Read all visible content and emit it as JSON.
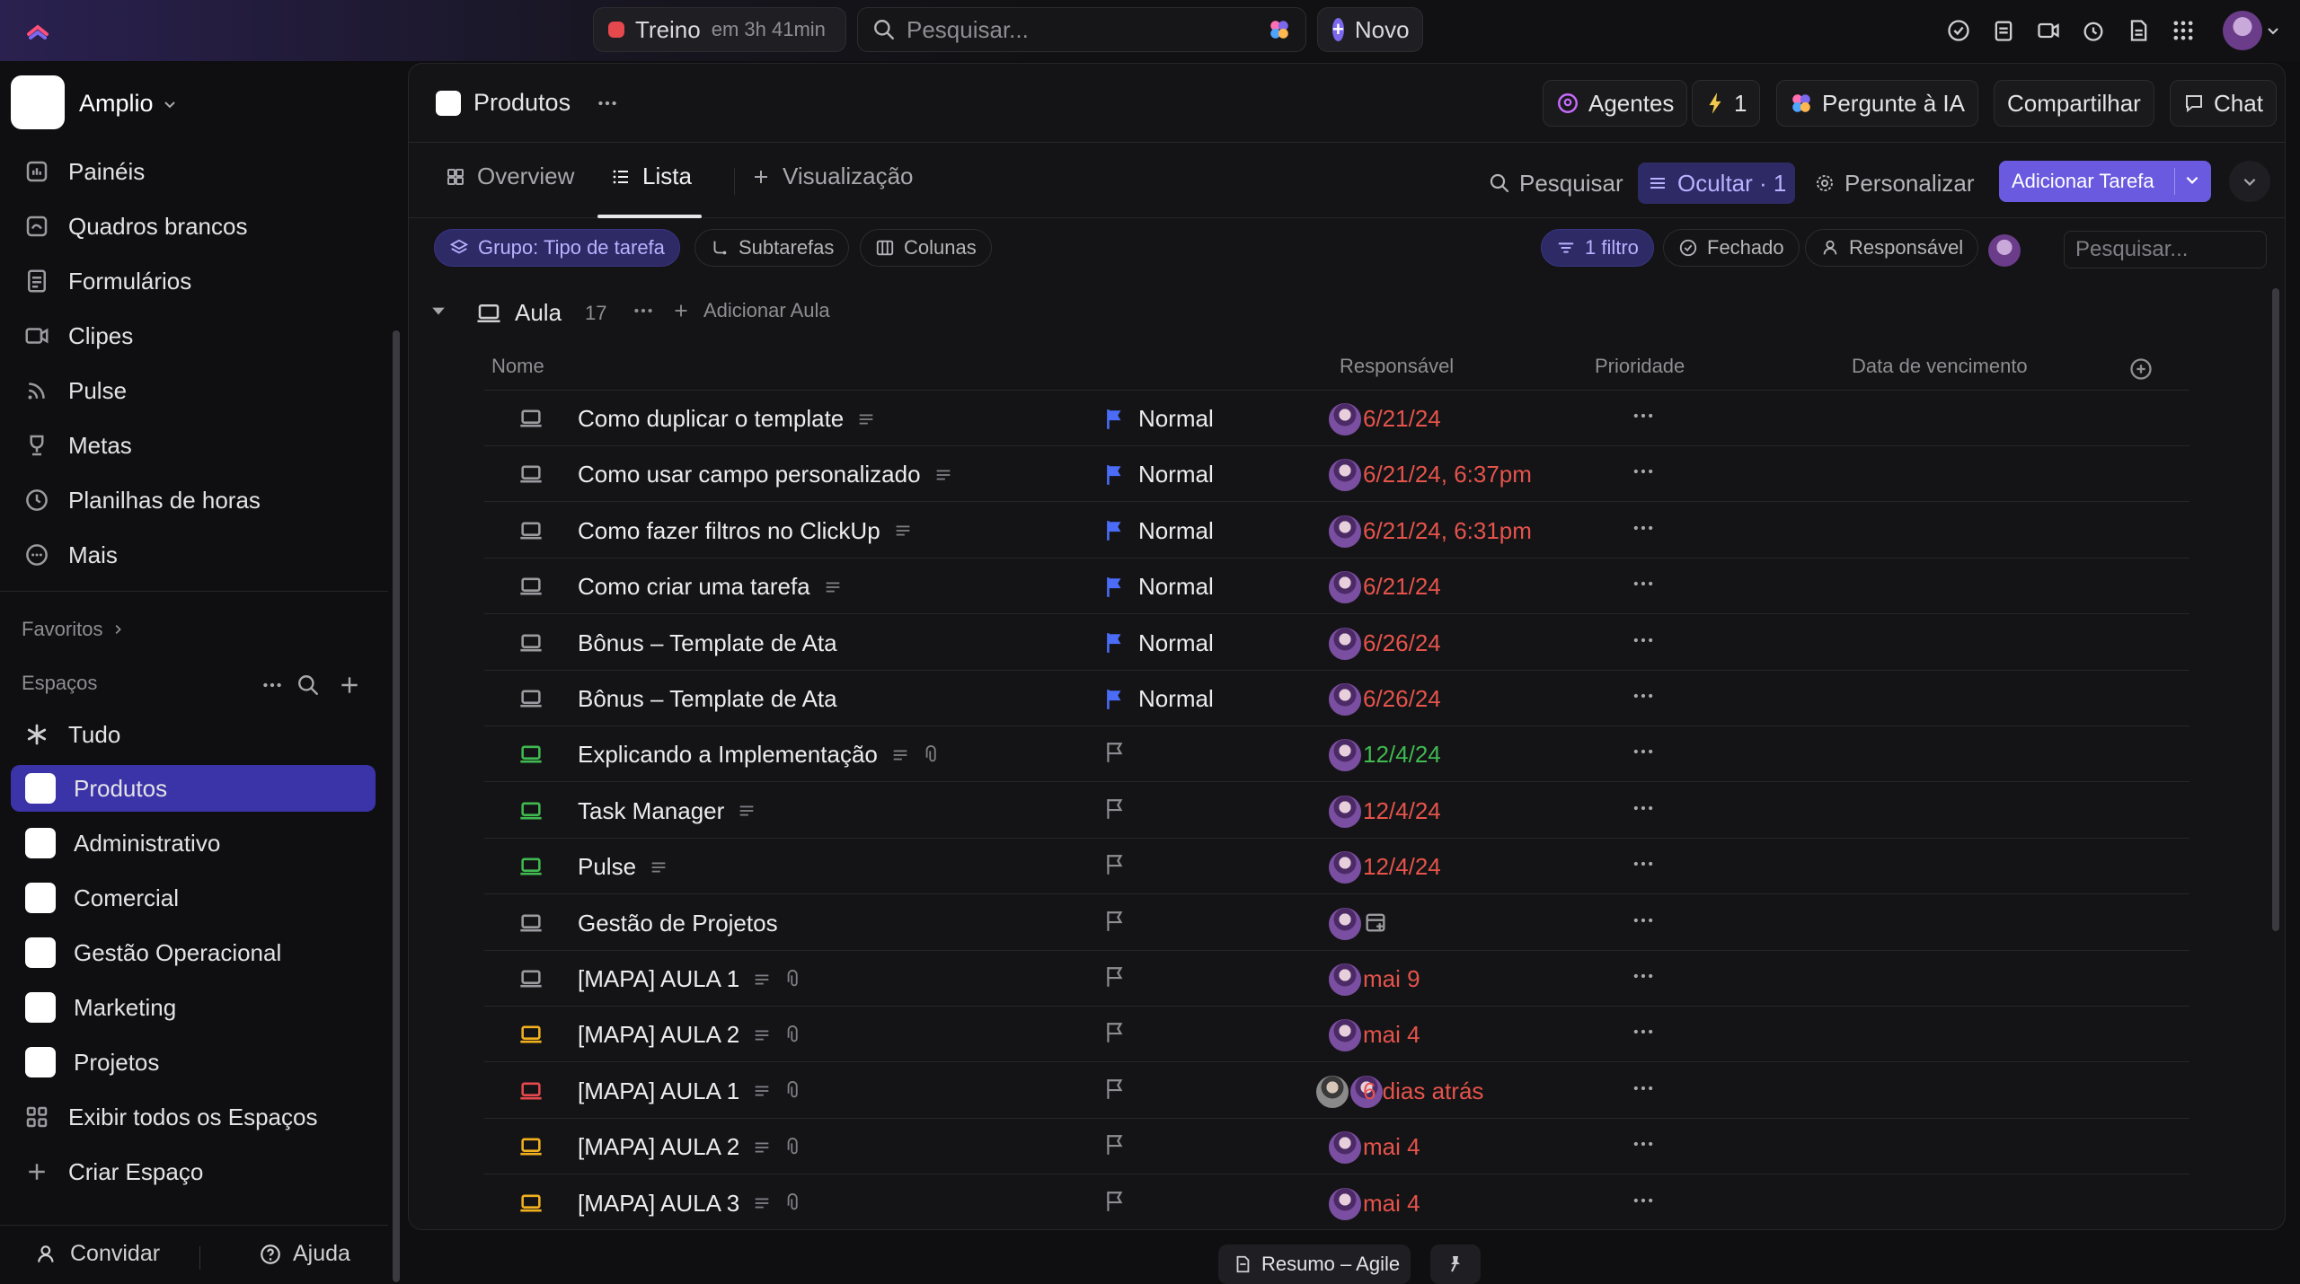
{
  "topbar": {
    "timer_label": "Treino",
    "timer_time": "em 3h 41min",
    "search_placeholder": "Pesquisar...",
    "new_label": "Novo"
  },
  "workspace": {
    "name": "Amplio"
  },
  "sidebar": {
    "nav": [
      {
        "label": "Painéis",
        "icon": "dashboard-icon"
      },
      {
        "label": "Quadros brancos",
        "icon": "whiteboard-icon"
      },
      {
        "label": "Formulários",
        "icon": "form-icon"
      },
      {
        "label": "Clipes",
        "icon": "video-icon"
      },
      {
        "label": "Pulse",
        "icon": "pulse-icon"
      },
      {
        "label": "Metas",
        "icon": "trophy-icon"
      },
      {
        "label": "Planilhas de horas",
        "icon": "clock-icon"
      },
      {
        "label": "Mais",
        "icon": "more-circle-icon"
      }
    ],
    "favorites_label": "Favoritos",
    "spaces_label": "Espaços",
    "all_label": "Tudo",
    "spaces": [
      "Produtos",
      "Administrativo",
      "Comercial",
      "Gestão Operacional",
      "Marketing",
      "Projetos"
    ],
    "show_all_label": "Exibir todos os Espaços",
    "create_label": "Criar Espaço"
  },
  "bottombar": {
    "invite_label": "Convidar",
    "help_label": "Ajuda",
    "doc_label": "Resumo – Agile"
  },
  "main": {
    "title": "Produtos",
    "agents_label": "Agentes",
    "bolt_count": "1",
    "ask_ai_label": "Pergunte à IA",
    "share_label": "Compartilhar",
    "chat_label": "Chat",
    "tabs": [
      "Overview",
      "Lista",
      "Visualização"
    ],
    "search_label": "Pesquisar",
    "hide_label": "Ocultar · 1",
    "customize_label": "Personalizar",
    "add_task_label": "Adicionar Tarefa",
    "chips": {
      "group": "Grupo: Tipo de tarefa",
      "subtasks": "Subtarefas",
      "columns": "Colunas",
      "filter": "1 filtro",
      "closed": "Fechado",
      "assignee": "Responsável"
    },
    "filter_search_placeholder": "Pesquisar...",
    "group": {
      "name": "Aula",
      "count": "17",
      "add_label": "Adicionar Aula"
    },
    "columns": {
      "name": "Nome",
      "assignee": "Responsável",
      "priority": "Prioridade",
      "due": "Data de vencimento"
    }
  },
  "colors": {
    "accent": "#7b68ee",
    "overdue": "#e5534b",
    "future": "#3fb950",
    "flag_blue": "#4a6cf7",
    "icon_gray": "#9a9aa0",
    "icon_green": "#3fb950",
    "icon_yellow": "#f2b01e",
    "icon_red": "#e5484d"
  },
  "tasks": [
    {
      "name": "Como duplicar o template",
      "icon_color": "gray",
      "desc": true,
      "clip": false,
      "assignees": 1,
      "priority": "Normal",
      "due": "6/21/24",
      "due_state": "overdue"
    },
    {
      "name": "Como usar campo personalizado",
      "icon_color": "gray",
      "desc": true,
      "clip": false,
      "assignees": 1,
      "priority": "Normal",
      "due": "6/21/24, 6:37pm",
      "due_state": "overdue"
    },
    {
      "name": "Como fazer filtros no ClickUp",
      "icon_color": "gray",
      "desc": true,
      "clip": false,
      "assignees": 1,
      "priority": "Normal",
      "due": "6/21/24, 6:31pm",
      "due_state": "overdue"
    },
    {
      "name": "Como criar uma tarefa",
      "icon_color": "gray",
      "desc": true,
      "clip": false,
      "assignees": 1,
      "priority": "Normal",
      "due": "6/21/24",
      "due_state": "overdue"
    },
    {
      "name": "Bônus – Template de Ata",
      "icon_color": "gray",
      "desc": false,
      "clip": false,
      "assignees": 1,
      "priority": "Normal",
      "due": "6/26/24",
      "due_state": "overdue"
    },
    {
      "name": "Bônus – Template de Ata",
      "icon_color": "gray",
      "desc": false,
      "clip": false,
      "assignees": 1,
      "priority": "Normal",
      "due": "6/26/24",
      "due_state": "overdue"
    },
    {
      "name": "Explicando a Implementação",
      "icon_color": "green",
      "desc": true,
      "clip": true,
      "assignees": 1,
      "priority": "",
      "due": "12/4/24",
      "due_state": "future"
    },
    {
      "name": "Task Manager",
      "icon_color": "green",
      "desc": true,
      "clip": false,
      "assignees": 1,
      "priority": "",
      "due": "12/4/24",
      "due_state": "overdue"
    },
    {
      "name": "Pulse",
      "icon_color": "green",
      "desc": true,
      "clip": false,
      "assignees": 1,
      "priority": "",
      "due": "12/4/24",
      "due_state": "overdue"
    },
    {
      "name": "Gestão de Projetos",
      "icon_color": "gray",
      "desc": false,
      "clip": false,
      "assignees": 1,
      "priority": "",
      "due": "",
      "due_state": "empty"
    },
    {
      "name": "[MAPA] AULA 1",
      "icon_color": "gray",
      "desc": true,
      "clip": true,
      "assignees": 1,
      "priority": "",
      "due": "mai 9",
      "due_state": "overdue"
    },
    {
      "name": "[MAPA] AULA 2",
      "icon_color": "yellow",
      "desc": true,
      "clip": true,
      "assignees": 1,
      "priority": "",
      "due": "mai 4",
      "due_state": "overdue"
    },
    {
      "name": "[MAPA] AULA 1",
      "icon_color": "red",
      "desc": true,
      "clip": true,
      "assignees": 2,
      "priority": "",
      "due": "6 dias atrás",
      "due_state": "overdue"
    },
    {
      "name": "[MAPA] AULA 2",
      "icon_color": "yellow",
      "desc": true,
      "clip": true,
      "assignees": 1,
      "priority": "",
      "due": "mai 4",
      "due_state": "overdue"
    },
    {
      "name": "[MAPA] AULA 3",
      "icon_color": "yellow",
      "desc": true,
      "clip": true,
      "assignees": 1,
      "priority": "",
      "due": "mai 4",
      "due_state": "overdue"
    }
  ]
}
